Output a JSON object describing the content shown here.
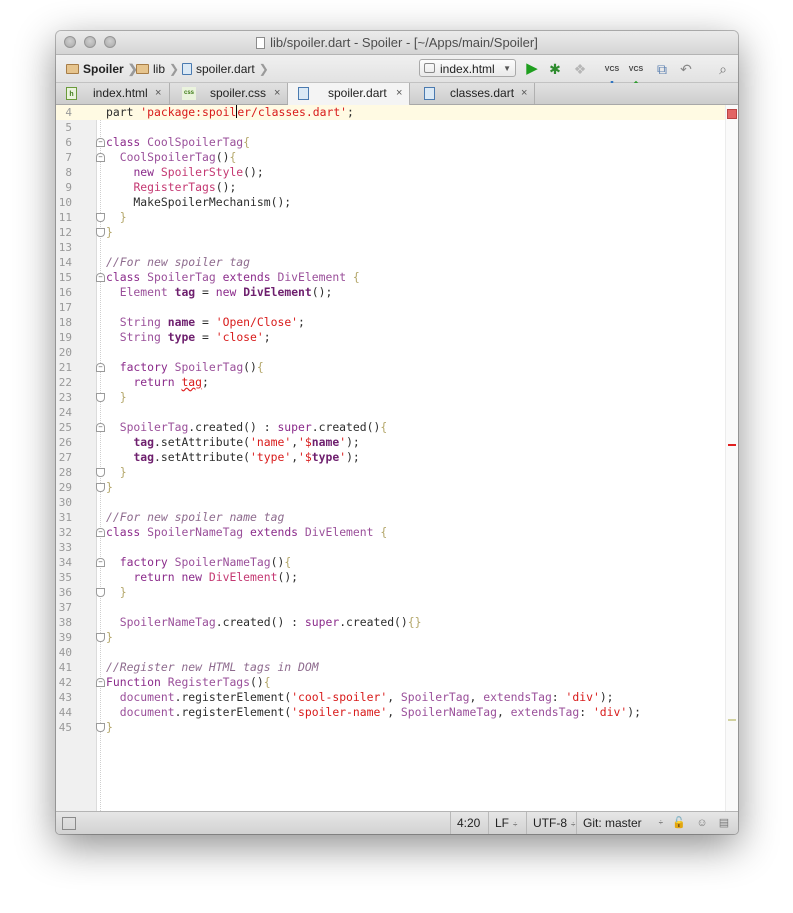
{
  "window": {
    "title": "lib/spoiler.dart - Spoiler - [~/Apps/main/Spoiler]"
  },
  "navbar": {
    "breadcrumbs": [
      {
        "label": "Spoiler",
        "icon": "folder-icon"
      },
      {
        "label": "lib",
        "icon": "folder-icon"
      },
      {
        "label": "spoiler.dart",
        "icon": "dart-file-icon"
      }
    ],
    "run_config": "index.html",
    "toolbar_icons": [
      "run-icon",
      "debug-icon",
      "coverage-icon",
      "vcs-update-icon",
      "vcs-commit-icon",
      "compare-icon",
      "revert-icon",
      "search-icon"
    ],
    "vcs_label": "VCS"
  },
  "tabs": [
    {
      "label": "index.html",
      "icon_text": "h",
      "active": false
    },
    {
      "label": "spoiler.css",
      "icon_text": "css",
      "active": false
    },
    {
      "label": "spoiler.dart",
      "icon_text": "",
      "active": true
    },
    {
      "label": "classes.dart",
      "icon_text": "",
      "active": false
    }
  ],
  "close_glyph": "×",
  "editor": {
    "current_line": 4,
    "lines": [
      {
        "n": "4",
        "fold": "",
        "tokens": [
          [
            "def",
            "part "
          ],
          [
            "str",
            "'package:spoiler/classes.dart'"
          ],
          [
            "def",
            ";"
          ]
        ]
      },
      {
        "n": "5",
        "fold": "",
        "tokens": []
      },
      {
        "n": "6",
        "fold": "start",
        "tokens": [
          [
            "kw",
            "class "
          ],
          [
            "cls",
            "CoolSpoilerTag"
          ],
          [
            "brc",
            "{"
          ]
        ]
      },
      {
        "n": "7",
        "fold": "start",
        "tokens": [
          [
            "def",
            "  "
          ],
          [
            "cls",
            "CoolSpoilerTag"
          ],
          [
            "def",
            "()"
          ],
          [
            "brc",
            "{"
          ]
        ]
      },
      {
        "n": "8",
        "fold": "",
        "tokens": [
          [
            "def",
            "    "
          ],
          [
            "kw",
            "new "
          ],
          [
            "mth",
            "SpoilerStyle"
          ],
          [
            "def",
            "();"
          ]
        ]
      },
      {
        "n": "9",
        "fold": "",
        "tokens": [
          [
            "def",
            "    "
          ],
          [
            "mth",
            "RegisterTags"
          ],
          [
            "def",
            "();"
          ]
        ]
      },
      {
        "n": "10",
        "fold": "",
        "tokens": [
          [
            "def",
            "    MakeSpoilerMechanism();"
          ]
        ]
      },
      {
        "n": "11",
        "fold": "end",
        "tokens": [
          [
            "def",
            "  "
          ],
          [
            "brc",
            "}"
          ]
        ]
      },
      {
        "n": "12",
        "fold": "end",
        "tokens": [
          [
            "brc",
            "}"
          ]
        ]
      },
      {
        "n": "13",
        "fold": "",
        "tokens": []
      },
      {
        "n": "14",
        "fold": "",
        "tokens": [
          [
            "cmt",
            "//For new spoiler tag"
          ]
        ]
      },
      {
        "n": "15",
        "fold": "start",
        "tokens": [
          [
            "kw",
            "class "
          ],
          [
            "cls",
            "SpoilerTag "
          ],
          [
            "kw",
            "extends "
          ],
          [
            "cls",
            "DivElement "
          ],
          [
            "brc",
            "{"
          ]
        ]
      },
      {
        "n": "16",
        "fold": "",
        "tokens": [
          [
            "def",
            "  "
          ],
          [
            "cls",
            "Element "
          ],
          [
            "fld",
            "tag"
          ],
          [
            "def",
            " = "
          ],
          [
            "kw",
            "new "
          ],
          [
            "fld",
            "DivElement"
          ],
          [
            "def",
            "();"
          ]
        ]
      },
      {
        "n": "17",
        "fold": "",
        "tokens": []
      },
      {
        "n": "18",
        "fold": "",
        "tokens": [
          [
            "def",
            "  "
          ],
          [
            "cls",
            "String "
          ],
          [
            "fld",
            "name"
          ],
          [
            "def",
            " = "
          ],
          [
            "str",
            "'Open/Close'"
          ],
          [
            "def",
            ";"
          ]
        ]
      },
      {
        "n": "19",
        "fold": "",
        "tokens": [
          [
            "def",
            "  "
          ],
          [
            "cls",
            "String "
          ],
          [
            "fld",
            "type"
          ],
          [
            "def",
            " = "
          ],
          [
            "str",
            "'close'"
          ],
          [
            "def",
            ";"
          ]
        ]
      },
      {
        "n": "20",
        "fold": "",
        "tokens": []
      },
      {
        "n": "21",
        "fold": "start",
        "tokens": [
          [
            "def",
            "  "
          ],
          [
            "kw",
            "factory "
          ],
          [
            "cls",
            "SpoilerTag"
          ],
          [
            "def",
            "()"
          ],
          [
            "brc",
            "{"
          ]
        ]
      },
      {
        "n": "22",
        "fold": "",
        "tokens": [
          [
            "def",
            "    "
          ],
          [
            "kw",
            "return "
          ],
          [
            "str err",
            "tag"
          ],
          [
            "def",
            ";"
          ]
        ]
      },
      {
        "n": "23",
        "fold": "end",
        "tokens": [
          [
            "def",
            "  "
          ],
          [
            "brc",
            "}"
          ]
        ]
      },
      {
        "n": "24",
        "fold": "",
        "tokens": []
      },
      {
        "n": "25",
        "fold": "start",
        "tokens": [
          [
            "def",
            "  "
          ],
          [
            "cls",
            "SpoilerTag"
          ],
          [
            "def",
            ".created() : "
          ],
          [
            "kw",
            "super"
          ],
          [
            "def",
            ".created()"
          ],
          [
            "brc",
            "{"
          ]
        ]
      },
      {
        "n": "26",
        "fold": "",
        "tokens": [
          [
            "def",
            "    "
          ],
          [
            "fld",
            "tag"
          ],
          [
            "def",
            ".setAttribute("
          ],
          [
            "str",
            "'name'"
          ],
          [
            "def",
            ","
          ],
          [
            "str",
            "'$"
          ],
          [
            "fld",
            "name"
          ],
          [
            "str",
            "'"
          ],
          [
            "def",
            ");"
          ]
        ]
      },
      {
        "n": "27",
        "fold": "",
        "tokens": [
          [
            "def",
            "    "
          ],
          [
            "fld",
            "tag"
          ],
          [
            "def",
            ".setAttribute("
          ],
          [
            "str",
            "'type'"
          ],
          [
            "def",
            ","
          ],
          [
            "str",
            "'$"
          ],
          [
            "fld",
            "type"
          ],
          [
            "str",
            "'"
          ],
          [
            "def",
            ");"
          ]
        ]
      },
      {
        "n": "28",
        "fold": "end",
        "tokens": [
          [
            "def",
            "  "
          ],
          [
            "brc",
            "}"
          ]
        ]
      },
      {
        "n": "29",
        "fold": "end",
        "tokens": [
          [
            "brc",
            "}"
          ]
        ]
      },
      {
        "n": "30",
        "fold": "",
        "tokens": []
      },
      {
        "n": "31",
        "fold": "",
        "tokens": [
          [
            "cmt",
            "//For new spoiler name tag"
          ]
        ]
      },
      {
        "n": "32",
        "fold": "start",
        "tokens": [
          [
            "kw",
            "class "
          ],
          [
            "cls",
            "SpoilerNameTag "
          ],
          [
            "kw",
            "extends "
          ],
          [
            "cls",
            "DivElement "
          ],
          [
            "brc",
            "{"
          ]
        ]
      },
      {
        "n": "33",
        "fold": "",
        "tokens": []
      },
      {
        "n": "34",
        "fold": "start",
        "tokens": [
          [
            "def",
            "  "
          ],
          [
            "kw",
            "factory "
          ],
          [
            "cls",
            "SpoilerNameTag"
          ],
          [
            "def",
            "()"
          ],
          [
            "brc",
            "{"
          ]
        ]
      },
      {
        "n": "35",
        "fold": "",
        "tokens": [
          [
            "def",
            "    "
          ],
          [
            "kw",
            "return "
          ],
          [
            "kw",
            "new "
          ],
          [
            "mth",
            "DivElement"
          ],
          [
            "def",
            "();"
          ]
        ]
      },
      {
        "n": "36",
        "fold": "end",
        "tokens": [
          [
            "def",
            "  "
          ],
          [
            "brc",
            "}"
          ]
        ]
      },
      {
        "n": "37",
        "fold": "",
        "tokens": []
      },
      {
        "n": "38",
        "fold": "",
        "tokens": [
          [
            "def",
            "  "
          ],
          [
            "cls",
            "SpoilerNameTag"
          ],
          [
            "def",
            ".created() : "
          ],
          [
            "kw",
            "super"
          ],
          [
            "def",
            ".created()"
          ],
          [
            "brc",
            "{}"
          ]
        ]
      },
      {
        "n": "39",
        "fold": "end",
        "tokens": [
          [
            "brc",
            "}"
          ]
        ]
      },
      {
        "n": "40",
        "fold": "",
        "tokens": []
      },
      {
        "n": "41",
        "fold": "",
        "tokens": [
          [
            "cmt",
            "//Register new HTML tags in DOM"
          ]
        ]
      },
      {
        "n": "42",
        "fold": "start",
        "tokens": [
          [
            "kw",
            "Function "
          ],
          [
            "cls",
            "RegisterTags"
          ],
          [
            "def",
            "()"
          ],
          [
            "brc",
            "{"
          ]
        ]
      },
      {
        "n": "43",
        "fold": "",
        "tokens": [
          [
            "def",
            "  "
          ],
          [
            "cls",
            "document"
          ],
          [
            "def",
            ".registerElement("
          ],
          [
            "str",
            "'cool-spoiler'"
          ],
          [
            "def",
            ", "
          ],
          [
            "cls",
            "SpoilerTag"
          ],
          [
            "def",
            ", "
          ],
          [
            "cls",
            "extendsTag"
          ],
          [
            "def",
            ": "
          ],
          [
            "str",
            "'div'"
          ],
          [
            "def",
            ");"
          ]
        ]
      },
      {
        "n": "44",
        "fold": "",
        "tokens": [
          [
            "def",
            "  "
          ],
          [
            "cls",
            "document"
          ],
          [
            "def",
            ".registerElement("
          ],
          [
            "str",
            "'spoiler-name'"
          ],
          [
            "def",
            ", "
          ],
          [
            "cls",
            "SpoilerNameTag"
          ],
          [
            "def",
            ", "
          ],
          [
            "cls",
            "extendsTag"
          ],
          [
            "def",
            ": "
          ],
          [
            "str",
            "'div'"
          ],
          [
            "def",
            ");"
          ]
        ]
      },
      {
        "n": "45",
        "fold": "end",
        "tokens": [
          [
            "brc",
            "}"
          ]
        ]
      }
    ]
  },
  "statusbar": {
    "position": "4:20",
    "line_sep": "LF",
    "encoding": "UTF-8",
    "vcs_branch": "Git: master",
    "updown_arrow": "÷"
  },
  "colors": {
    "keyword": "#8b2b8b",
    "string": "#d81b1b",
    "comment": "#8e6b8e",
    "error": "#e02020",
    "run_green": "#1f9f1f"
  }
}
